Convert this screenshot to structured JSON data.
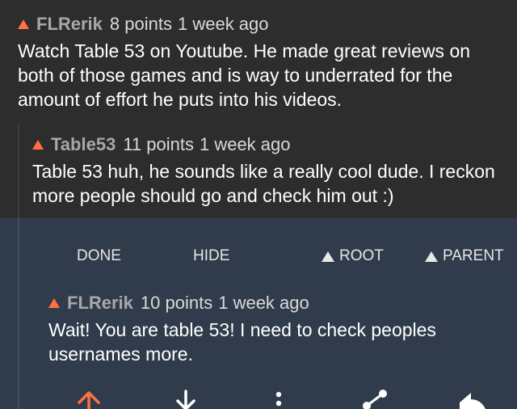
{
  "comments": [
    {
      "author": "FLRerik",
      "points": "8 points",
      "time": "1 week ago",
      "body": "Watch Table 53 on Youtube. He made great reviews on both of those games and is way to underrated for the amount of effort he puts into his videos."
    },
    {
      "author": "Table53",
      "points": "11 points",
      "time": "1 week ago",
      "body": "Table 53 huh, he sounds like a really cool dude. I reckon more people should go and check him out :)"
    },
    {
      "author": "FLRerik",
      "points": "10 points",
      "time": "1 week ago",
      "body": "Wait! You are table 53! I need to check peoples usernames more."
    }
  ],
  "actions": {
    "done": "DONE",
    "hide": "HIDE",
    "root": "ROOT",
    "parent": "PARENT"
  },
  "colors": {
    "upvote_accent": "#ff7043",
    "background": "#2d2d2d",
    "selected_background": "#303c4b"
  },
  "bottom_icons": [
    "upvote-icon",
    "downvote-icon",
    "more-icon",
    "share-icon",
    "reply-icon"
  ]
}
